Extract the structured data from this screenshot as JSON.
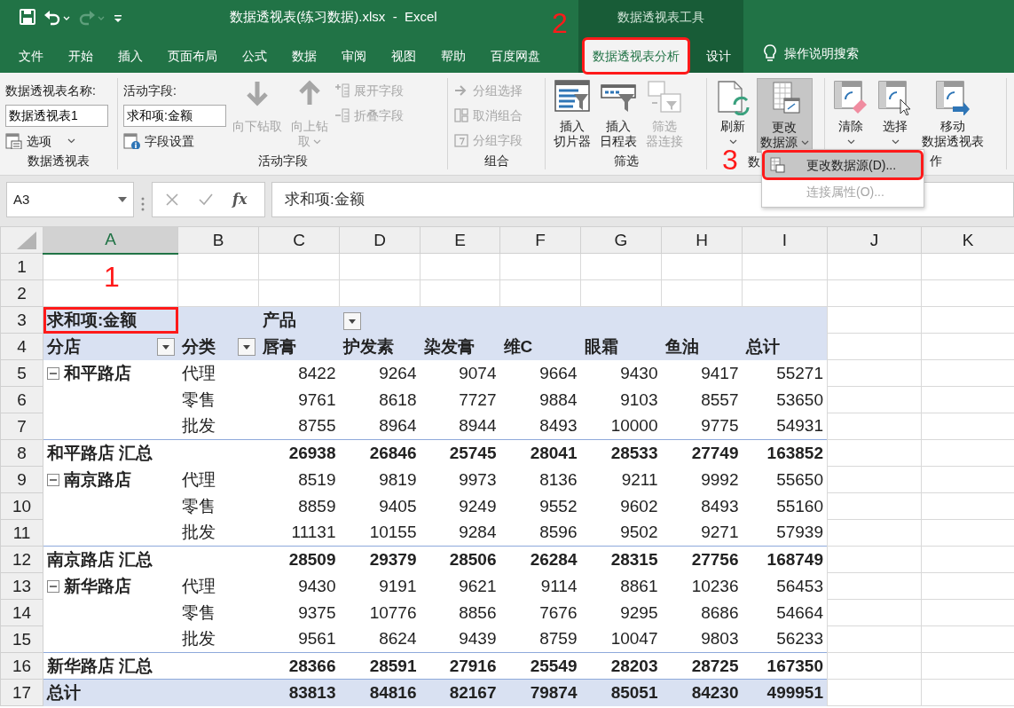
{
  "quick_access": [
    {
      "kind": "save",
      "disabled": false
    },
    {
      "kind": "undo",
      "disabled": false
    },
    {
      "kind": "redo",
      "disabled": true
    },
    {
      "kind": "customize",
      "disabled": false
    }
  ],
  "window": {
    "title": "数据透视表(练习数据).xlsx  -  Excel",
    "context_title": "数据透视表工具"
  },
  "tabs": [
    {
      "label": "文件",
      "selected": false
    },
    {
      "label": "开始",
      "selected": false
    },
    {
      "label": "插入",
      "selected": false
    },
    {
      "label": "页面布局",
      "selected": false
    },
    {
      "label": "公式",
      "selected": false
    },
    {
      "label": "数据",
      "selected": false
    },
    {
      "label": "审阅",
      "selected": false
    },
    {
      "label": "视图",
      "selected": false
    },
    {
      "label": "帮助",
      "selected": false
    },
    {
      "label": "百度网盘",
      "selected": false
    },
    {
      "label": "数据透视表分析",
      "selected": true,
      "contextual": true,
      "annotated": true
    },
    {
      "label": "设计",
      "selected": false,
      "contextual": true
    }
  ],
  "tell_me": "操作说明搜索",
  "ribbon": {
    "groups": [
      {
        "label": "数据透视表",
        "items": [
          {
            "kind": "stack",
            "items": [
              {
                "kind": "text",
                "text": "数据透视表名称:"
              },
              {
                "kind": "input",
                "value": "数据透视表1"
              },
              {
                "kind": "small",
                "label": "选项",
                "caret": true,
                "disabled": false
              }
            ]
          }
        ]
      },
      {
        "label": "活动字段",
        "items": [
          {
            "kind": "stack",
            "items": [
              {
                "kind": "text",
                "text": "活动字段:"
              },
              {
                "kind": "input",
                "value": "求和项:金额"
              },
              {
                "kind": "small",
                "label": "字段设置",
                "caret": false,
                "disabled": false
              }
            ]
          },
          {
            "kind": "large",
            "lines": [
              "向下钻取"
            ],
            "caret": false,
            "disabled": true
          },
          {
            "kind": "large",
            "lines": [
              "向上钻",
              "取"
            ],
            "caret": true,
            "disabled": true
          },
          {
            "kind": "stack",
            "items": [
              {
                "kind": "small",
                "label": "展开字段",
                "caret": false,
                "disabled": true
              },
              {
                "kind": "small",
                "label": "折叠字段",
                "caret": false,
                "disabled": true
              }
            ]
          }
        ]
      },
      {
        "label": "组合",
        "items": [
          {
            "kind": "stack",
            "items": [
              {
                "kind": "small",
                "label": "分组选择",
                "caret": false,
                "disabled": true
              },
              {
                "kind": "small",
                "label": "取消组合",
                "caret": false,
                "disabled": true
              },
              {
                "kind": "small",
                "label": "分组字段",
                "caret": false,
                "disabled": true
              }
            ]
          }
        ]
      },
      {
        "label": "筛选",
        "items": [
          {
            "kind": "large",
            "lines": [
              "插入",
              "切片器"
            ],
            "caret": false,
            "disabled": false
          },
          {
            "kind": "large",
            "lines": [
              "插入",
              "日程表"
            ],
            "caret": false,
            "disabled": false
          },
          {
            "kind": "large",
            "lines": [
              "筛选",
              "器连接"
            ],
            "caret": false,
            "disabled": true
          }
        ]
      },
      {
        "label": "数",
        "items": [
          {
            "kind": "large",
            "lines": [
              "刷新"
            ],
            "caret": true,
            "disabled": false
          },
          {
            "kind": "large",
            "lines": [
              "更改",
              "数据源"
            ],
            "caret": true,
            "disabled": false,
            "pressed": true
          }
        ]
      },
      {
        "label": "作",
        "items": [
          {
            "kind": "large",
            "lines": [
              "清除"
            ],
            "caret": true,
            "disabled": false
          },
          {
            "kind": "large",
            "lines": [
              "选择"
            ],
            "caret": true,
            "disabled": false
          },
          {
            "kind": "large",
            "lines": [
              "移动",
              "数据透视表"
            ],
            "caret": false,
            "disabled": false
          }
        ]
      }
    ]
  },
  "dropdown_menu": [
    {
      "label": "更改数据源(D)...",
      "selected": true,
      "disabled": false,
      "annotated": true
    },
    {
      "label": "连接属性(O)...",
      "selected": false,
      "disabled": true
    }
  ],
  "formula_bar": {
    "name_box": "A3",
    "function_label": "fx",
    "content": "求和项:金额"
  },
  "columns": [
    {
      "label": "A",
      "selected": true
    },
    {
      "label": "B",
      "selected": false
    },
    {
      "label": "C",
      "selected": false
    },
    {
      "label": "D",
      "selected": false
    },
    {
      "label": "E",
      "selected": false
    },
    {
      "label": "F",
      "selected": false
    },
    {
      "label": "G",
      "selected": false
    },
    {
      "label": "H",
      "selected": false
    },
    {
      "label": "I",
      "selected": false
    },
    {
      "label": "J",
      "selected": false
    },
    {
      "label": "K",
      "selected": false
    }
  ],
  "row_numbers": [
    "1",
    "2",
    "3",
    "4",
    "5",
    "6",
    "7",
    "8",
    "9",
    "10",
    "11",
    "12",
    "13",
    "14",
    "15",
    "16",
    "17"
  ],
  "pivot": {
    "value_field": "求和项:金额",
    "value_field_annotated": true,
    "column_field": "产品",
    "column_field_filter": true,
    "header": [
      {
        "text": "分店",
        "filter": true
      },
      {
        "text": "分类",
        "filter": true
      },
      {
        "text": "唇膏",
        "filter": false
      },
      {
        "text": "护发素",
        "filter": false
      },
      {
        "text": "染发膏",
        "filter": false
      },
      {
        "text": "维C",
        "filter": false
      },
      {
        "text": "眼霜",
        "filter": false
      },
      {
        "text": "鱼油",
        "filter": false
      },
      {
        "text": "总计",
        "filter": false
      }
    ],
    "rows": [
      {
        "kind": "item",
        "store": "和平路店",
        "expanded": true,
        "category": "代理",
        "values": [
          "8422",
          "9264",
          "9074",
          "9664",
          "9430",
          "9417",
          "55271"
        ]
      },
      {
        "kind": "item",
        "category": "零售",
        "values": [
          "9761",
          "8618",
          "7727",
          "9884",
          "9103",
          "8557",
          "53650"
        ]
      },
      {
        "kind": "item",
        "category": "批发",
        "values": [
          "8755",
          "8964",
          "8944",
          "8493",
          "10000",
          "9775",
          "54931"
        ]
      },
      {
        "kind": "subtotal",
        "label": "和平路店 汇总",
        "values": [
          "26938",
          "26846",
          "25745",
          "28041",
          "28533",
          "27749",
          "163852"
        ]
      },
      {
        "kind": "item",
        "store": "南京路店",
        "expanded": true,
        "category": "代理",
        "values": [
          "8519",
          "9819",
          "9973",
          "8136",
          "9211",
          "9992",
          "55650"
        ]
      },
      {
        "kind": "item",
        "category": "零售",
        "values": [
          "8859",
          "9405",
          "9249",
          "9552",
          "9602",
          "8493",
          "55160"
        ]
      },
      {
        "kind": "item",
        "category": "批发",
        "values": [
          "11131",
          "10155",
          "9284",
          "8596",
          "9502",
          "9271",
          "57939"
        ]
      },
      {
        "kind": "subtotal",
        "label": "南京路店 汇总",
        "values": [
          "28509",
          "29379",
          "28506",
          "26284",
          "28315",
          "27756",
          "168749"
        ]
      },
      {
        "kind": "item",
        "store": "新华路店",
        "expanded": true,
        "category": "代理",
        "values": [
          "9430",
          "9191",
          "9621",
          "9114",
          "8861",
          "10236",
          "56453"
        ]
      },
      {
        "kind": "item",
        "category": "零售",
        "values": [
          "9375",
          "10776",
          "8856",
          "7676",
          "9295",
          "8686",
          "54664"
        ]
      },
      {
        "kind": "item",
        "category": "批发",
        "values": [
          "9561",
          "8624",
          "9439",
          "8759",
          "10047",
          "9803",
          "56233"
        ]
      },
      {
        "kind": "subtotal",
        "label": "新华路店 汇总",
        "values": [
          "28366",
          "28591",
          "27916",
          "25549",
          "28203",
          "28725",
          "167350"
        ]
      },
      {
        "kind": "total",
        "label": "总计",
        "values": [
          "83813",
          "84816",
          "82167",
          "79874",
          "85051",
          "84230",
          "499951"
        ]
      }
    ]
  },
  "annotations": [
    {
      "text": "1"
    },
    {
      "text": "2"
    },
    {
      "text": "3"
    }
  ]
}
